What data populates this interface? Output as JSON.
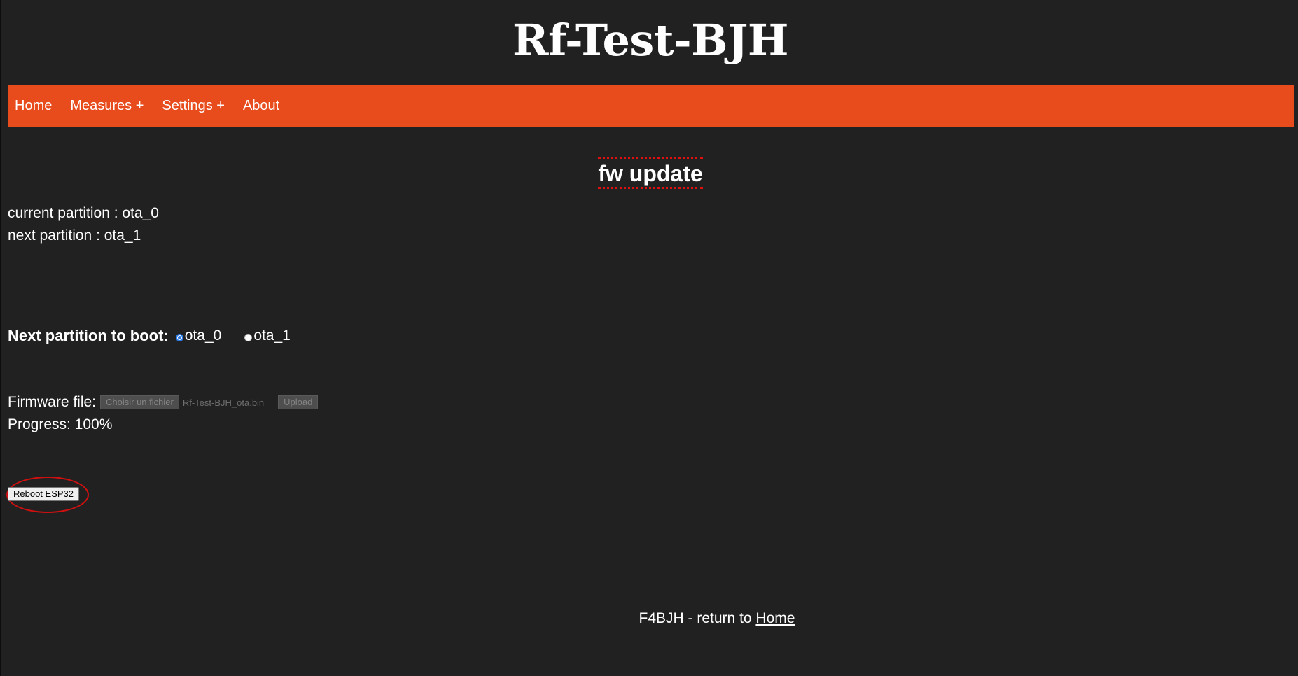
{
  "header": {
    "site_title": "Rf-Test-BJH"
  },
  "nav": {
    "items": [
      {
        "label": "Home"
      },
      {
        "label": "Measures +"
      },
      {
        "label": "Settings +"
      },
      {
        "label": "About"
      }
    ],
    "background_color": "#e84c1c"
  },
  "main": {
    "section_title": "fw update",
    "current_partition": "current partition : ota_0",
    "next_partition": "next partition : ota_1",
    "boot": {
      "label": "Next partition to boot:",
      "options": [
        {
          "label": "ota_0",
          "checked": true
        },
        {
          "label": "ota_1",
          "checked": false
        }
      ]
    },
    "firmware": {
      "label": "Firmware file:",
      "choose_button": "Choisir un fichier",
      "file_name": "Rf-Test-BJH_ota.bin",
      "upload_button": "Upload"
    },
    "progress": "Progress: 100%",
    "reboot_button": "Reboot ESP32"
  },
  "footer": {
    "text": "F4BJH - return to ",
    "link": "Home"
  },
  "colors": {
    "background": "#212121",
    "accent": "#e84c1c",
    "highlight": "#d01010"
  }
}
